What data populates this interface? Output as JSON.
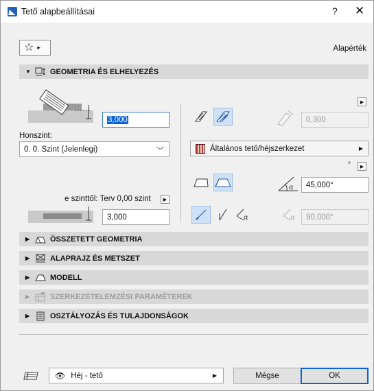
{
  "window": {
    "title": "Tető alapbeállításai",
    "help": "?",
    "close": "✕"
  },
  "favorites": {
    "star": "☆",
    "arrow": "▸"
  },
  "defaults_label": "Alapérték",
  "sections": [
    {
      "label": "GEOMETRIA ÉS ELHELYEZÉS",
      "expanded": true,
      "disabled": false,
      "icon": "geometry-icon"
    },
    {
      "label": "ÖSSZETETT GEOMETRIA",
      "expanded": false,
      "disabled": false,
      "icon": "complex-geometry-icon"
    },
    {
      "label": "ALAPRAJZ ÉS METSZET",
      "expanded": false,
      "disabled": false,
      "icon": "floorplan-section-icon"
    },
    {
      "label": "MODELL",
      "expanded": false,
      "disabled": false,
      "icon": "model-icon"
    },
    {
      "label": "SZERKEZETELEMZÉSI PARAMÉTEREK",
      "expanded": false,
      "disabled": true,
      "icon": "structural-analysis-icon"
    },
    {
      "label": "OSZTÁLYOZÁS ÉS TULAJDONSÁGOK",
      "expanded": false,
      "disabled": false,
      "icon": "classification-icon"
    }
  ],
  "geometry": {
    "thickness_value": "3,000",
    "home_story_label": "Honszint:",
    "home_story_value": "0. 0. Szint (Jelenlegi)",
    "offset_ref_label": "e szinttől: Terv 0,00 szint",
    "offset_value": "3,000",
    "edge_value": "0,300",
    "structure_label": "Általános tető/héjszerkezet",
    "degree_mark": "°",
    "slope_angle": "45,000°",
    "edge_angle": "90,000°"
  },
  "footer": {
    "layer_label": "Héj - tető",
    "cancel_label": "Mégse",
    "ok_label": "OK"
  },
  "colors": {
    "accent": "#0a64d4",
    "header_bg": "#d8d8d8",
    "active_icon_bg": "#cfe1f6"
  }
}
